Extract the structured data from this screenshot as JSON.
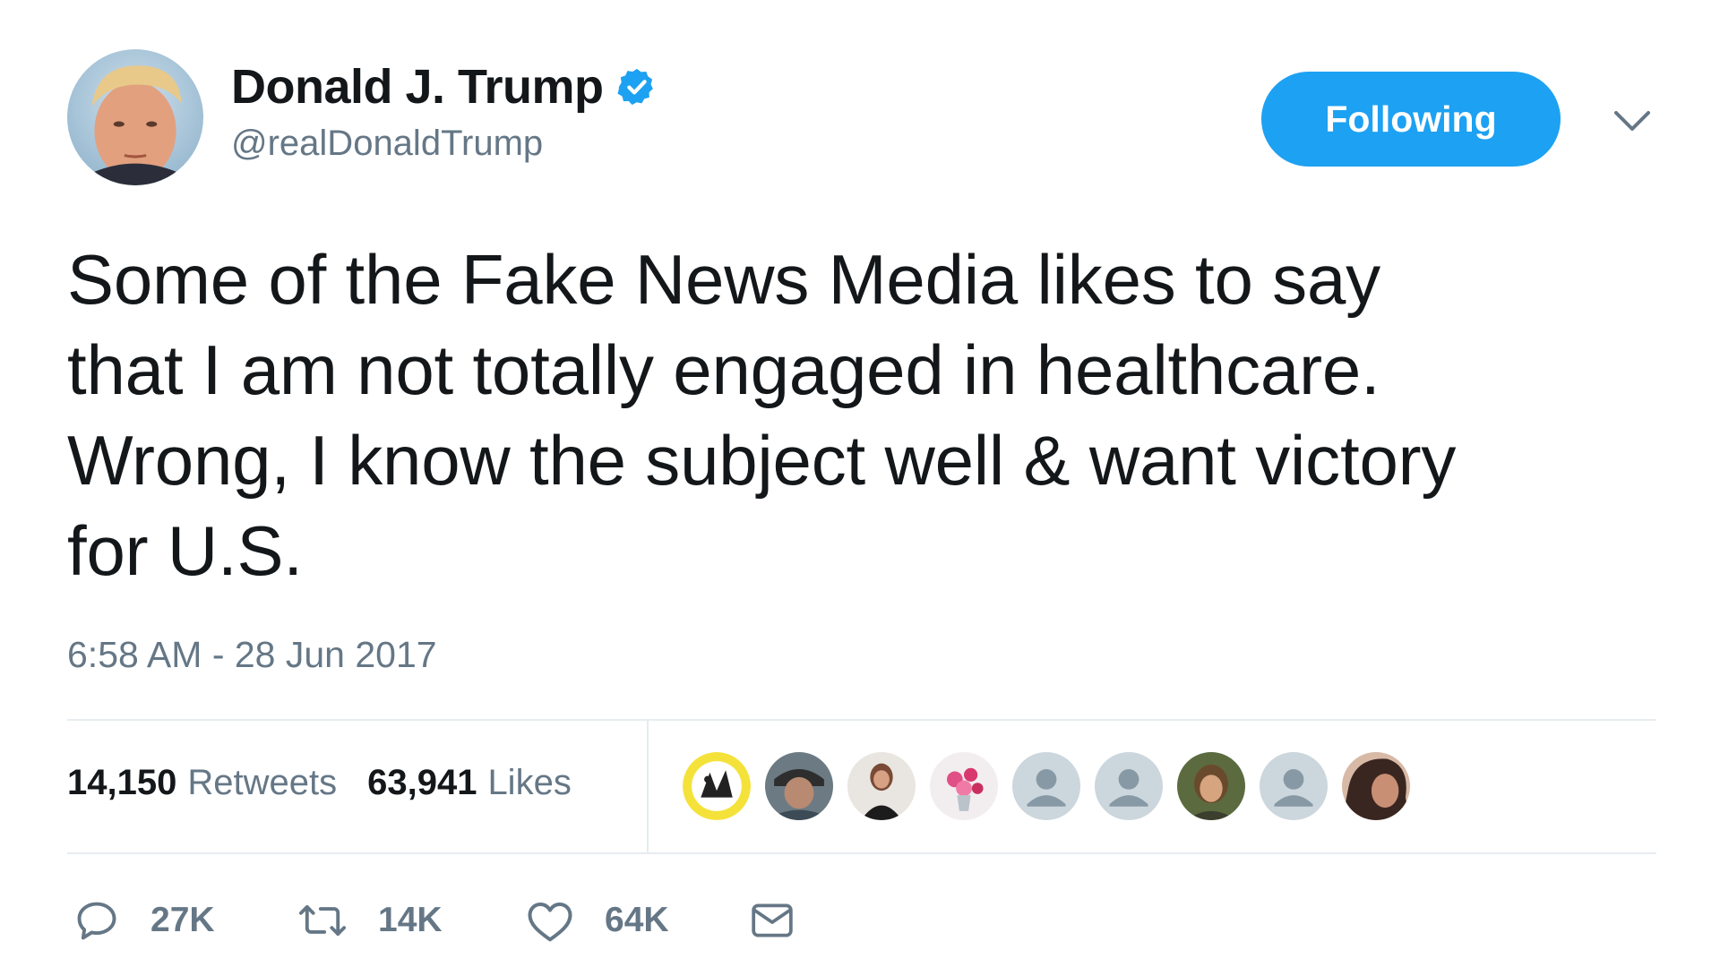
{
  "author": {
    "display_name": "Donald J. Trump",
    "handle": "@realDonaldTrump",
    "verified": true,
    "avatar_icon": "profile-photo"
  },
  "follow_button": {
    "label": "Following",
    "color": "#1da1f2"
  },
  "menu_icon": "chevron-down-icon",
  "tweet": {
    "lines": [
      "Some of the Fake News Media likes to say",
      "that I am not totally engaged in healthcare.",
      "Wrong, I know the subject well & want victory",
      "for U.S."
    ],
    "timestamp": "6:58 AM - 28 Jun 2017"
  },
  "stats": {
    "retweets_count": "14,150",
    "retweets_label": "Retweets",
    "likes_count": "63,941",
    "likes_label": "Likes"
  },
  "likers": [
    {
      "icon": "cartoon-avatar"
    },
    {
      "icon": "photo-avatar"
    },
    {
      "icon": "photo-avatar"
    },
    {
      "icon": "flowers-avatar"
    },
    {
      "icon": "default-avatar"
    },
    {
      "icon": "default-avatar"
    },
    {
      "icon": "photo-avatar"
    },
    {
      "icon": "default-avatar"
    },
    {
      "icon": "photo-avatar"
    }
  ],
  "actions": {
    "reply_count": "27K",
    "retweet_count": "14K",
    "like_count": "64K"
  },
  "colors": {
    "accent": "#1da1f2",
    "text": "#14171a",
    "secondary": "#657786",
    "divider": "#e6ecf0",
    "icon": "#657786"
  }
}
